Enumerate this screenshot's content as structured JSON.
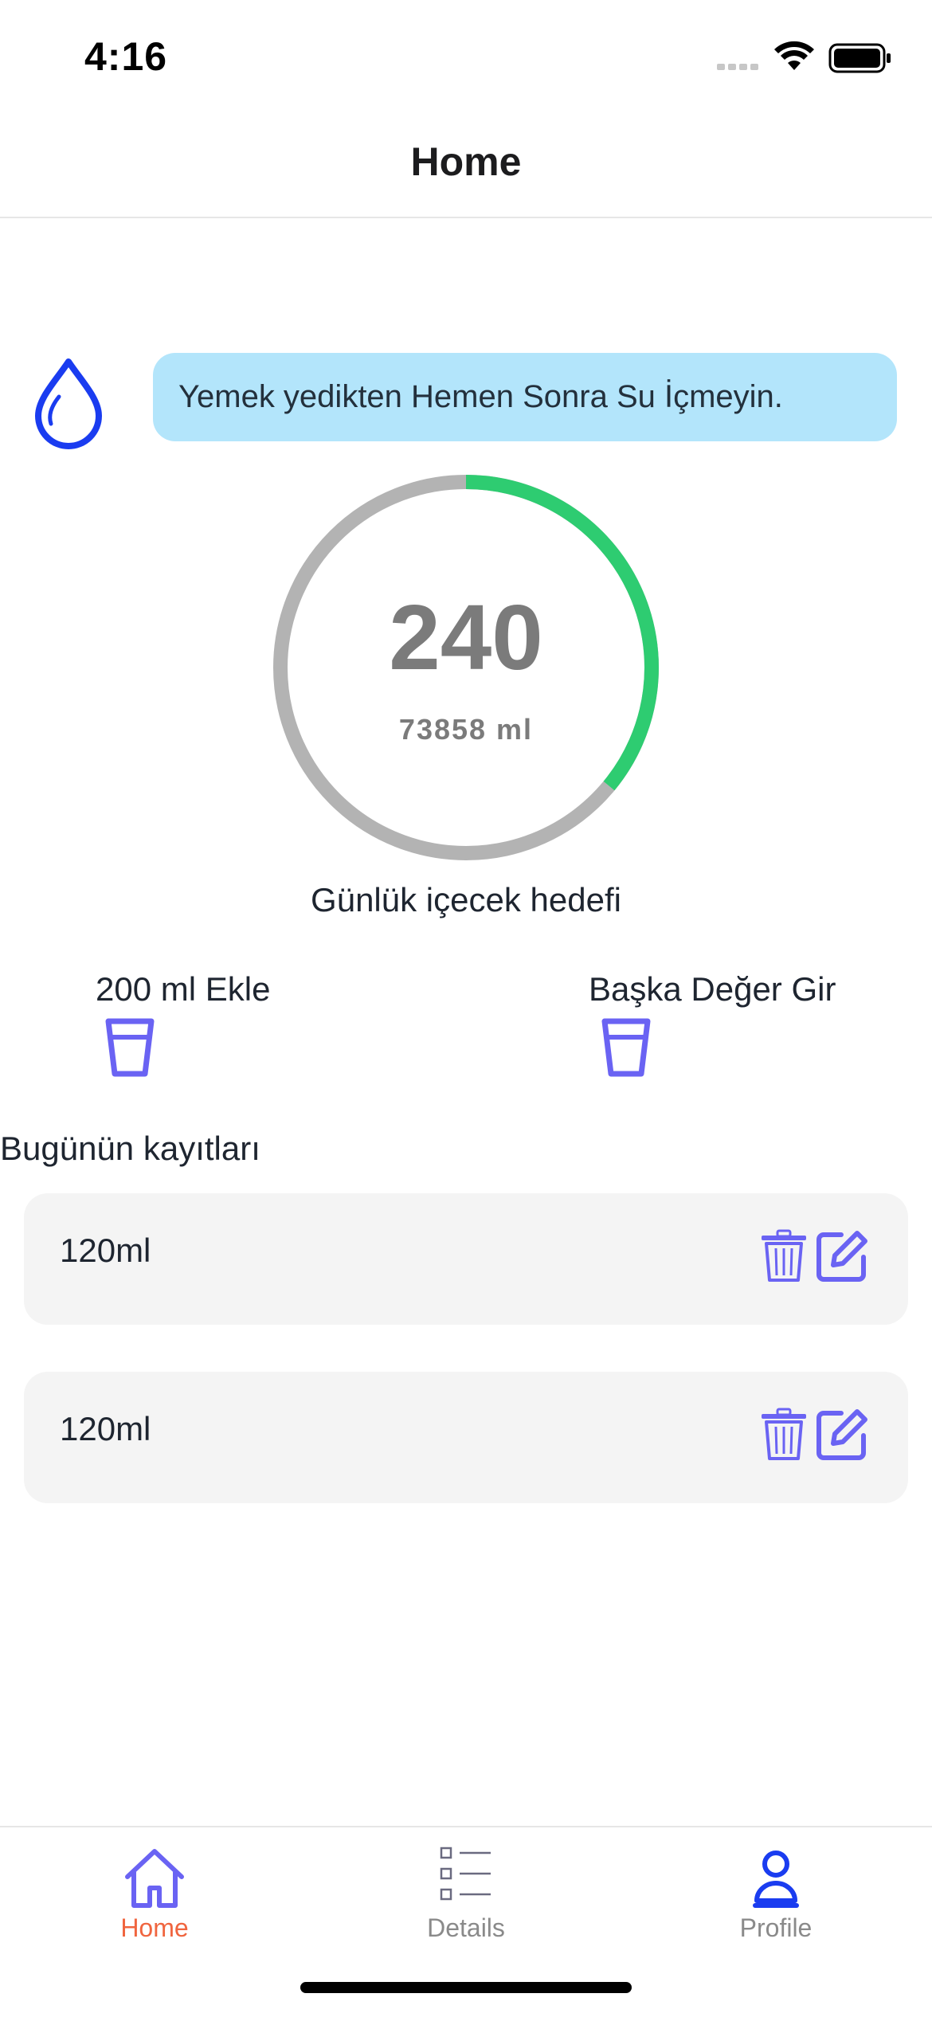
{
  "status_bar": {
    "time": "4:16"
  },
  "nav": {
    "title": "Home"
  },
  "tip": {
    "icon": "water-drop-icon",
    "text": "Yemek yedikten Hemen Sonra Su İçmeyin."
  },
  "progress": {
    "value": "240",
    "sub_amount": "73858",
    "sub_unit": "ml",
    "caption": "Günlük içecek hedefi",
    "fraction": 0.36,
    "colors": {
      "track": "#b3b3b3",
      "fill": "#2ecc71"
    }
  },
  "actions": {
    "add_200": {
      "label": "200 ml Ekle",
      "icon": "cup-icon"
    },
    "custom": {
      "label": "Başka Değer Gir",
      "icon": "cup-icon"
    }
  },
  "records": {
    "heading": "Bugünün kayıtları",
    "items": [
      {
        "amount": "120ml"
      },
      {
        "amount": "120ml"
      }
    ]
  },
  "tabbar": {
    "tabs": [
      {
        "label": "Home",
        "icon": "home-icon",
        "active": true
      },
      {
        "label": "Details",
        "icon": "list-icon",
        "active": false
      },
      {
        "label": "Profile",
        "icon": "person-icon",
        "active": false
      }
    ]
  },
  "colors": {
    "accent": "#6a63f3",
    "active_tab": "#f0653f",
    "tip_bg": "#b3e5fb",
    "drop": "#1a3cf0"
  }
}
